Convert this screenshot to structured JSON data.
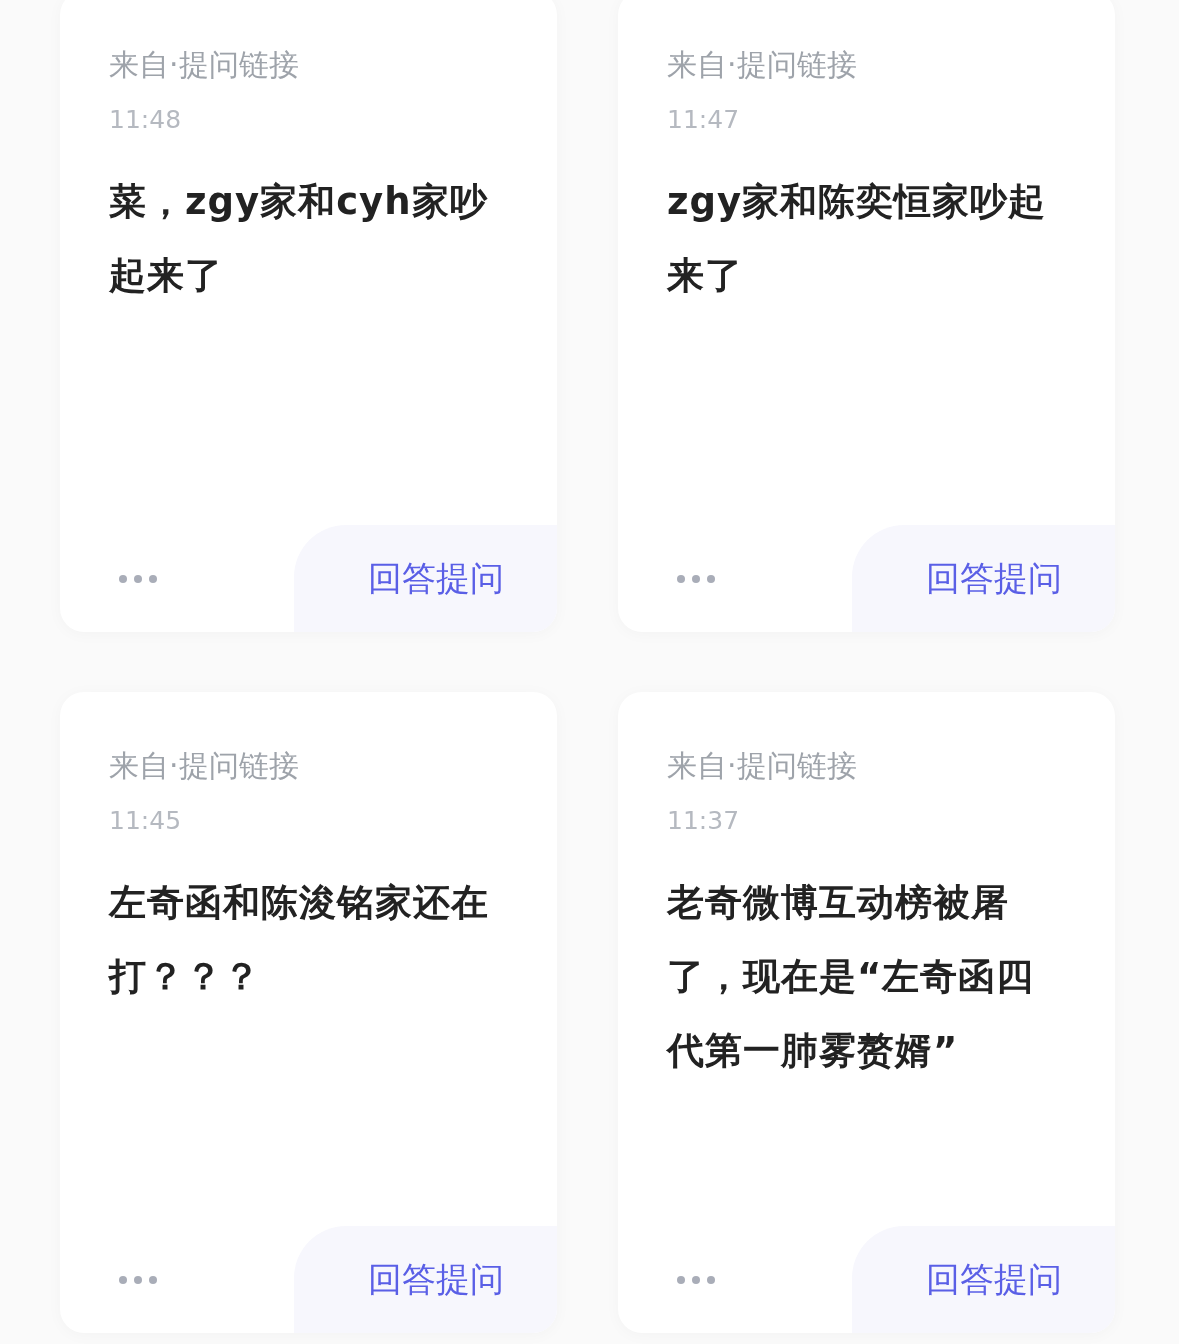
{
  "cards": [
    {
      "source": "来自·提问链接",
      "time": "11:48",
      "question": "菜，zgy家和cyh家吵起来了",
      "action": "回答提问"
    },
    {
      "source": "来自·提问链接",
      "time": "11:47",
      "question": "zgy家和陈奕恒家吵起来了",
      "action": "回答提问"
    },
    {
      "source": "来自·提问链接",
      "time": "11:45",
      "question": "左奇函和陈浚铭家还在打？？？",
      "action": "回答提问"
    },
    {
      "source": "来自·提问链接",
      "time": "11:37",
      "question": "老奇微博互动榜被屠了，现在是“左奇函四代第一肺雾赘婿”",
      "action": "回答提问"
    }
  ]
}
